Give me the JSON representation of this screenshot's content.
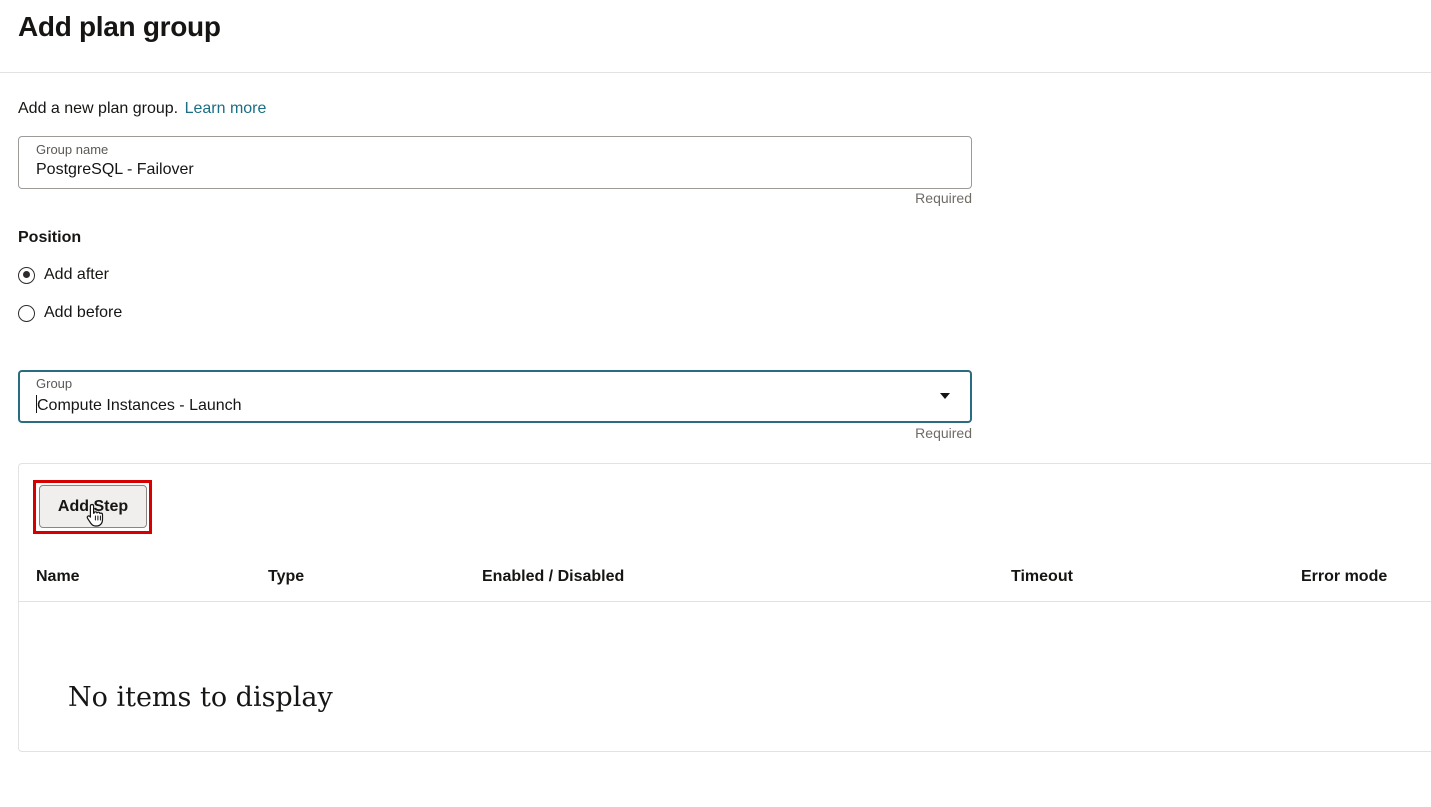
{
  "page": {
    "title": "Add plan group"
  },
  "intro": {
    "text": "Add a new plan group.",
    "link": "Learn more"
  },
  "group_name": {
    "label": "Group name",
    "value": "PostgreSQL - Failover",
    "hint": "Required"
  },
  "position": {
    "label": "Position",
    "options": [
      {
        "label": "Add after",
        "selected": true
      },
      {
        "label": "Add before",
        "selected": false
      }
    ]
  },
  "group": {
    "label": "Group",
    "value": "Compute Instances - Launch",
    "hint": "Required"
  },
  "steps": {
    "add_button": "Add Step",
    "columns": [
      "Name",
      "Type",
      "Enabled / Disabled",
      "Timeout",
      "Error mode"
    ],
    "empty_message": "No items to display"
  },
  "colors": {
    "link": "#1a6e85",
    "focus_border": "#2b6d80",
    "highlight": "#d70000"
  },
  "icons": {
    "dropdown": "caret-down-icon",
    "cursor": "hand-pointer-icon"
  }
}
